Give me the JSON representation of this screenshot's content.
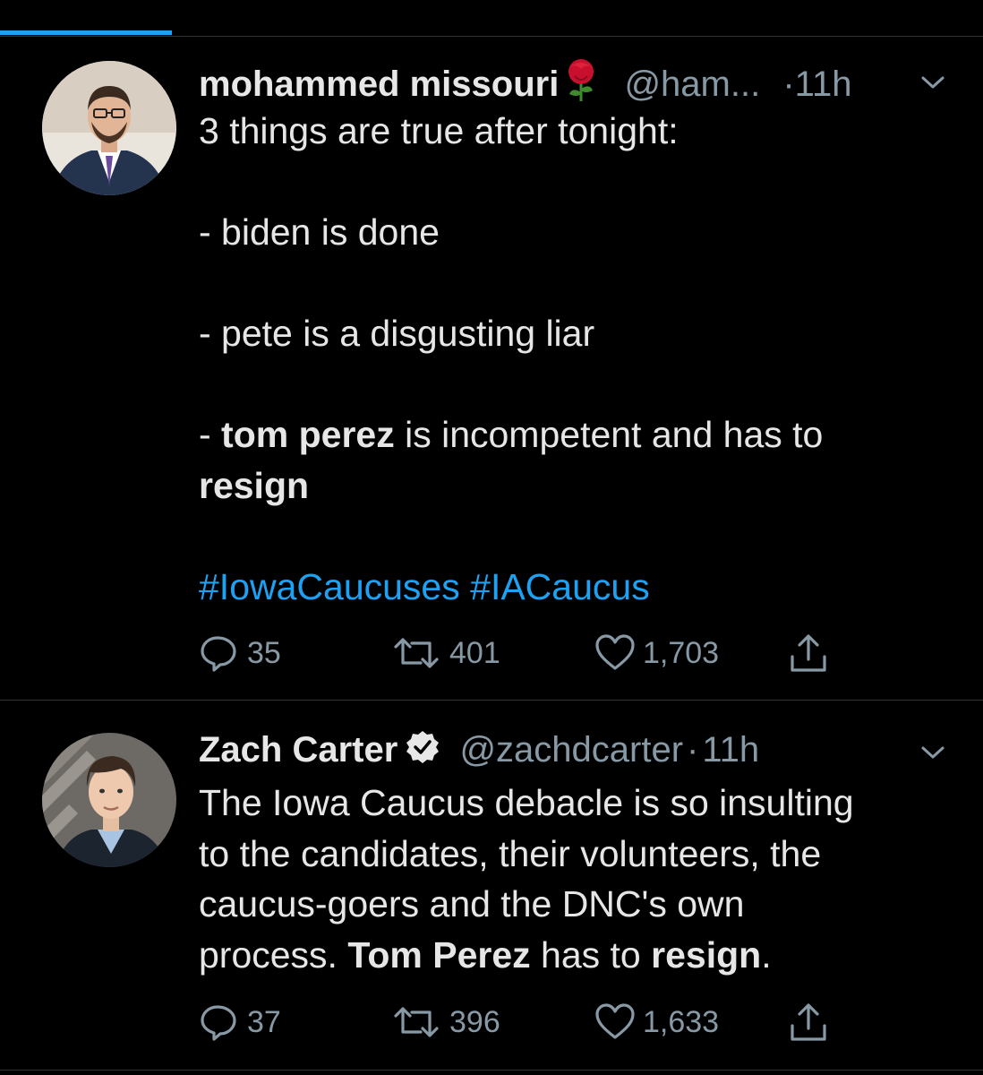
{
  "colors": {
    "background": "#000000",
    "accent": "#1da1f2",
    "muted": "#8899a6",
    "divider": "#2f3336"
  },
  "progress": {
    "fraction": 0.175
  },
  "tweets": [
    {
      "author_name": "mohammed missouri",
      "name_emoji_icon": "rose-icon",
      "handle": "@ham...",
      "dot": "·",
      "time": "11h",
      "body": {
        "line1": "3 things are true after tonight:",
        "line2": "- biden is done",
        "line3": "- pete is a disgusting liar",
        "line4_prefix": "- ",
        "line4_bold": "tom perez",
        "line4_rest": " is incompetent and has to",
        "line5_bold": "resign",
        "hashtag1": "#IowaCaucuses",
        "hashtag2": "#IACaucus"
      },
      "replies": "35",
      "retweets": "401",
      "likes": "1,703"
    },
    {
      "author_name": "Zach Carter",
      "verified_icon": "verified-badge-icon",
      "handle": "@zachdcarter",
      "dot": "·",
      "time": "11h",
      "body": {
        "line1": "The Iowa Caucus debacle is so insulting",
        "line2": "to the candidates, their volunteers, the",
        "line3": "caucus-goers and the DNC's own",
        "line4_prefix": "process. ",
        "line4_bold1": "Tom Perez",
        "line4_mid": " has to ",
        "line4_bold2": "resign",
        "line4_end": "."
      },
      "replies": "37",
      "retweets": "396",
      "likes": "1,633"
    }
  ]
}
